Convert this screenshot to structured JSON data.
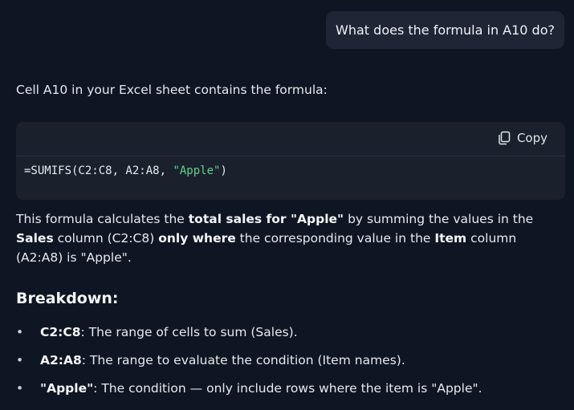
{
  "user_message": "What does the formula in A10 do?",
  "response": {
    "intro": "Cell A10 in your Excel sheet contains the formula:",
    "code_block": {
      "copy_label": "Copy",
      "code_prefix": "=SUMIFS(C2:C8, A2:A8, ",
      "code_string": "\"Apple\"",
      "code_suffix": ")"
    },
    "explanation": {
      "t1": "This formula calculates the ",
      "b1": "total sales for \"Apple\"",
      "t2": " by summing the values in the ",
      "b2": "Sales",
      "t3": " column (C2:C8) ",
      "b3": "only where",
      "t4": " the corresponding value in the ",
      "b4": "Item",
      "t5": " column (A2:A8) is \"Apple\"."
    },
    "breakdown_heading": "Breakdown:",
    "bullet_symbol": "•",
    "bullets": [
      {
        "term": "C2:C8",
        "text": ": The range of cells to sum (Sales)."
      },
      {
        "term": "A2:A8",
        "text": ": The range to evaluate the condition (Item names)."
      },
      {
        "term": "\"Apple\"",
        "text": ": The condition — only include rows where the item is \"Apple\"."
      }
    ]
  },
  "colors": {
    "background": "#0f1623",
    "user_bubble": "#1e2636",
    "code_background": "#1b212c",
    "string_literal": "#5fd38d"
  }
}
